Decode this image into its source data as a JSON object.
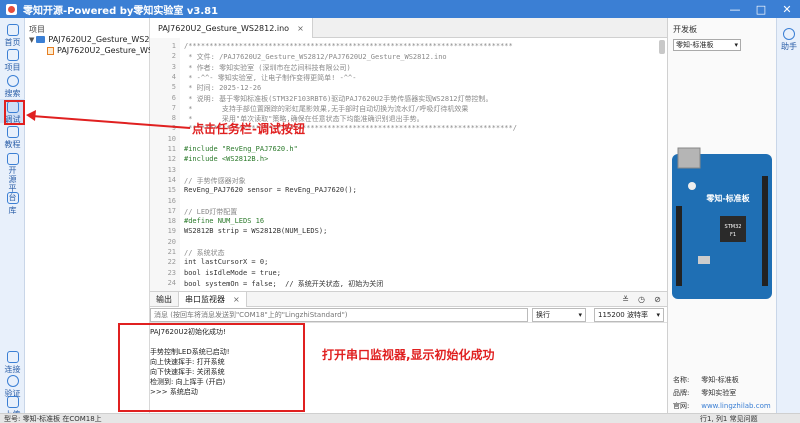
{
  "window": {
    "title": "零知开源-Powered by零知实验室 v3.81",
    "controls": [
      "—",
      "□",
      "✕"
    ]
  },
  "leftbar": {
    "items": [
      {
        "label": "首页",
        "icon": "home-icon"
      },
      {
        "label": "项目",
        "icon": "project-icon"
      },
      {
        "label": "搜索",
        "icon": "search-icon"
      },
      {
        "label": "调试",
        "icon": "debug-icon"
      },
      {
        "label": "教程",
        "icon": "book-icon"
      },
      {
        "label": "开源平台",
        "icon": "open-source-icon"
      },
      {
        "label": "库",
        "icon": "library-icon"
      },
      {
        "label": "连接",
        "icon": "connect-icon"
      },
      {
        "label": "验证",
        "icon": "verify-icon"
      },
      {
        "label": "上传",
        "icon": "upload-icon"
      }
    ]
  },
  "tree": {
    "header": "项目",
    "folder": "PAJ7620U2_Gesture_WS2812",
    "file": "PAJ7620U2_Gesture_WS2812"
  },
  "editor": {
    "tab_label": "PAJ7620U2_Gesture_WS2812.ino",
    "tab_close": "×",
    "lines": [
      {
        "n": "1",
        "cls": "c-comment",
        "text": "/*****************************************************************************"
      },
      {
        "n": "2",
        "cls": "c-comment",
        "text": " * 文件: /PAJ7620U2_Gesture_WS2812/PAJ7620U2_Gesture_WS2812.ino"
      },
      {
        "n": "3",
        "cls": "c-comment",
        "text": " * 作者: 零知实验室 (深圳市在芯间科技有限公司)"
      },
      {
        "n": "4",
        "cls": "c-comment",
        "text": " * -^^- 零知实验室, 让电子制作变得更简单! -^^-"
      },
      {
        "n": "5",
        "cls": "c-comment",
        "text": " * 时间: 2025-12-26"
      },
      {
        "n": "6",
        "cls": "c-comment",
        "text": " * 说明: 基于零知标准板(STM32F103RBT6)驱动PAJ7620U2手势传感器实现WS2812灯带控制。"
      },
      {
        "n": "7",
        "cls": "c-comment",
        "text": " *       支持手部位置跟踪的彩虹尾影效果,无手部时自动切换为流水灯/呼吸灯待机效果"
      },
      {
        "n": "8",
        "cls": "c-comment",
        "text": " *       采用\"单次读取\"策略,确保在任意状态下均能准确识别退出手势。"
      },
      {
        "n": "9",
        "cls": "c-comment",
        "text": " *****************************************************************************/"
      },
      {
        "n": "10",
        "cls": "c-norm",
        "text": ""
      },
      {
        "n": "11",
        "cls": "c-pre",
        "text": "#include \"RevEng_PAJ7620.h\""
      },
      {
        "n": "12",
        "cls": "c-pre",
        "text": "#include <WS2812B.h>"
      },
      {
        "n": "13",
        "cls": "c-norm",
        "text": ""
      },
      {
        "n": "14",
        "cls": "c-comment",
        "text": "// 手势传感器对象"
      },
      {
        "n": "15",
        "cls": "c-norm",
        "text": "RevEng_PAJ7620 sensor = RevEng_PAJ7620();"
      },
      {
        "n": "16",
        "cls": "c-norm",
        "text": ""
      },
      {
        "n": "17",
        "cls": "c-comment",
        "text": "// LED灯带配置"
      },
      {
        "n": "18",
        "cls": "c-pre",
        "text": "#define NUM_LEDS 16"
      },
      {
        "n": "19",
        "cls": "c-norm",
        "text": "WS2812B strip = WS2812B(NUM_LEDS);"
      },
      {
        "n": "20",
        "cls": "c-norm",
        "text": ""
      },
      {
        "n": "21",
        "cls": "c-comment",
        "text": "// 系统状态"
      },
      {
        "n": "22",
        "cls": "c-norm",
        "text": "int lastCursorX = 0;"
      },
      {
        "n": "23",
        "cls": "c-norm",
        "text": "bool isIdleMode = true;"
      },
      {
        "n": "24",
        "cls": "c-norm",
        "text": "bool systemOn = false;  // 系统开关状态, 初始为关闭"
      }
    ]
  },
  "panel": {
    "tab_output": "输出",
    "tab_serial": "串口监视器",
    "tab_close": "×",
    "input_placeholder": "消息 (按回车将消息发送到\"COM18\"上的\"LingzhiStandard\")",
    "line_ending": "换行",
    "baud": "115200 波特率",
    "output_lines": [
      "PAJ7620U2初始化成功!",
      "",
      "手势控制LED系统已启动!",
      "向上快速挥手: 打开系统",
      "向下快速挥手: 关闭系统",
      "检测到: 向上挥手 (开启)",
      ">>> 系统启动"
    ]
  },
  "board": {
    "header": "开发板",
    "selected": "零知-标准板",
    "name_label": "名称:",
    "name": "零知-标准板",
    "brand_label": "品牌:",
    "brand": "零知实验室",
    "site_label": "官网:",
    "site": "www.lingzhilab.com",
    "help": "助手",
    "chip_text": "STM32 F1",
    "board_title": "零知-标准板"
  },
  "status": {
    "left": "型号: 零知-标准板  在COM18上",
    "right": "行1, 列1  常见问题"
  },
  "annotations": {
    "debug_hint": "点击任务栏-调试按钮",
    "serial_hint": "打开串口监视器,显示初始化成功"
  },
  "colors": {
    "accent": "#3b7fd4",
    "annotation": "#e02020"
  }
}
